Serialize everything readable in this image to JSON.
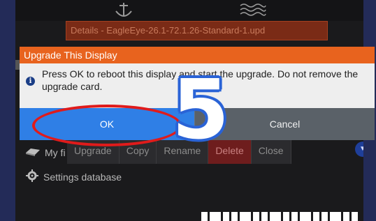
{
  "details_bar": {
    "text": "Details - EagleEye-26.1-72.1.26-Standard-1.upd"
  },
  "background_menu": {
    "my_files_label": "My fi",
    "settings_label": "Settings database",
    "buttons": [
      "Upgrade",
      "Copy",
      "Rename",
      "Delete",
      "Close"
    ]
  },
  "dialog": {
    "title": "Upgrade This Display",
    "message": "Press OK to reboot this display and start the upgrade. Do not remove the upgrade card.",
    "ok_label": "OK",
    "cancel_label": "Cancel"
  },
  "annotation": {
    "step_number": "5"
  },
  "icons": {
    "info": "info-icon",
    "anchor": "anchor-icon",
    "waves": "waves-icon",
    "files": "folder-icon",
    "settings": "gear-icon",
    "scroll_down": "chevron-down-icon"
  },
  "colors": {
    "dialog_title": "#e8631e",
    "ok_button": "#2f7fe6",
    "cancel_button": "#5a6168",
    "highlight_ring": "#e01b1b",
    "step_outline": "#2a63d6",
    "delete_button": "#6e1d1d"
  }
}
